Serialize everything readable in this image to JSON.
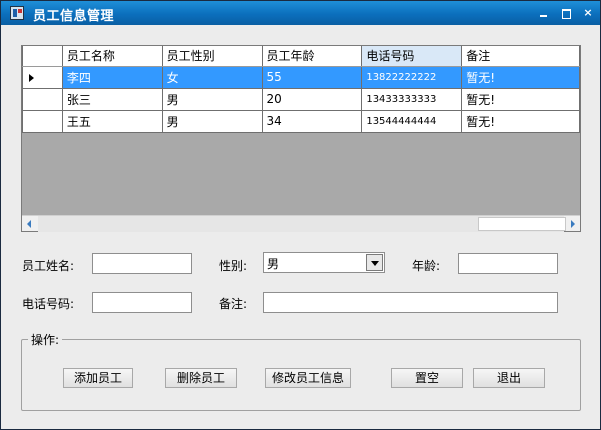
{
  "window": {
    "title": "员工信息管理",
    "controls": {
      "minimize": "minimize-icon",
      "maximize": "maximize-icon",
      "close": "×"
    }
  },
  "grid": {
    "columns": [
      "员工名称",
      "员工性别",
      "员工年龄",
      "电话号码",
      "备注"
    ],
    "rows": [
      {
        "name": "李四",
        "gender": "女",
        "age": "55",
        "phone": "13822222222",
        "note": "暂无!"
      },
      {
        "name": "张三",
        "gender": "男",
        "age": "20",
        "phone": "13433333333",
        "note": "暂无!"
      },
      {
        "name": "王五",
        "gender": "男",
        "age": "34",
        "phone": "13544444444",
        "note": "暂无!"
      }
    ],
    "selected_row": 0
  },
  "form": {
    "name_label": "员工姓名:",
    "name_value": "",
    "gender_label": "性别:",
    "gender_value": "男",
    "age_label": "年龄:",
    "age_value": "",
    "phone_label": "电话号码:",
    "phone_value": "",
    "note_label": "备注:",
    "note_value": ""
  },
  "actions": {
    "group_label": "操作:",
    "add": "添加员工",
    "delete": "删除员工",
    "edit": "修改员工信息",
    "clear": "置空",
    "exit": "退出"
  },
  "colors": {
    "titlebar": "#0b6fbd",
    "selection": "#3399ff",
    "grid_background": "#a9a9a9"
  }
}
